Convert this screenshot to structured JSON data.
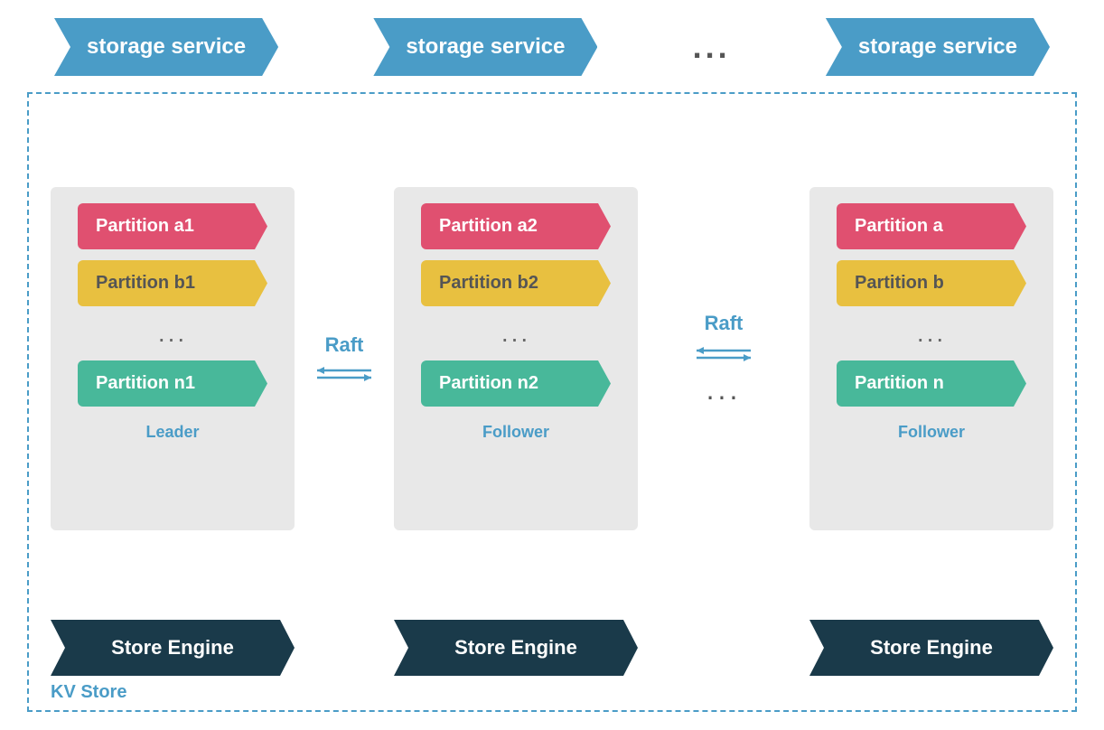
{
  "top": {
    "storage1": "storage service",
    "storage2": "storage service",
    "storage3": "storage service",
    "dots": "..."
  },
  "nodes": [
    {
      "partitions": [
        {
          "label": "Partition a1",
          "color": "red"
        },
        {
          "label": "Partition b1",
          "color": "yellow"
        },
        {
          "label": "Partition n1",
          "color": "green"
        }
      ],
      "role": "Leader"
    },
    {
      "partitions": [
        {
          "label": "Partition a2",
          "color": "red"
        },
        {
          "label": "Partition b2",
          "color": "yellow"
        },
        {
          "label": "Partition n2",
          "color": "green"
        }
      ],
      "role": "Follower"
    },
    {
      "partitions": [
        {
          "label": "Partition a",
          "color": "red"
        },
        {
          "label": "Partition b",
          "color": "yellow"
        },
        {
          "label": "Partition n",
          "color": "green"
        }
      ],
      "role": "Follower"
    }
  ],
  "raft_label": "Raft",
  "node_dots": "...",
  "middle_dots": "...",
  "engines": [
    "Store Engine",
    "Store Engine",
    "Store Engine"
  ],
  "kv_store_label": "KV Store"
}
